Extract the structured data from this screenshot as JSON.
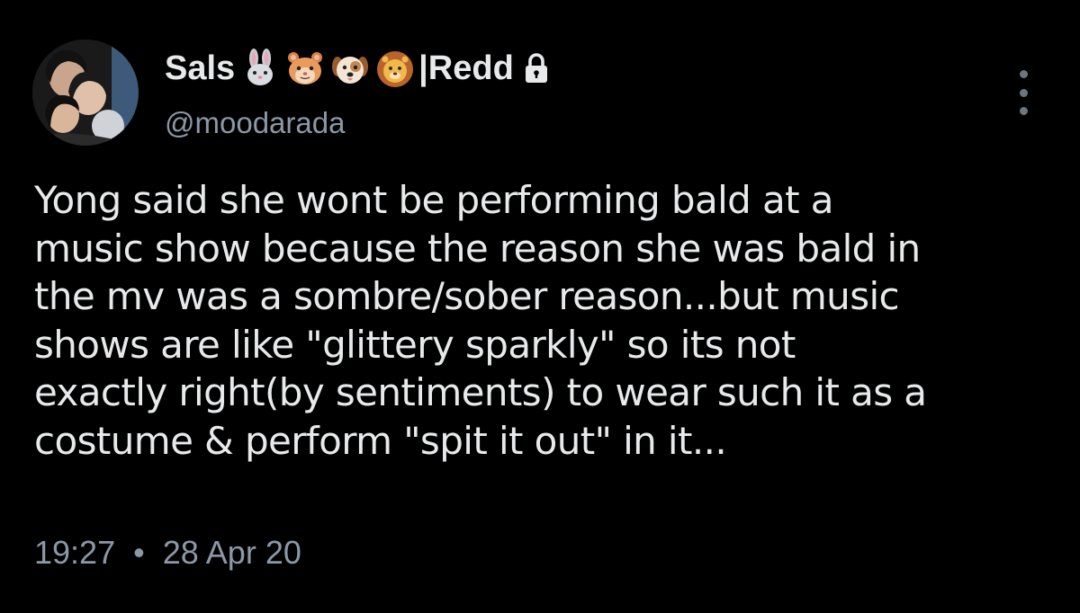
{
  "user": {
    "display_name": "Sals",
    "name_suffix": "|Redd",
    "handle": "@moodarada",
    "emoji_icons": [
      "rabbit-face-icon",
      "hamster-face-icon",
      "dog-face-icon",
      "lion-face-icon"
    ],
    "protected_icon": "lock-icon",
    "avatar": "profile-photo"
  },
  "tweet": {
    "lines": [
      "Yong said she wont be performing bald at a",
      "music show because the reason she was bald in",
      "the mv was a sombre/sober reason...but music",
      "shows are like \"glittery sparkly\" so its not",
      "exactly right(by sentiments) to wear such it as a",
      "costume & perform \"spit it out\" in it..."
    ],
    "time": "19:27",
    "separator": "•",
    "date": "28 Apr 20"
  },
  "menu": {
    "icon": "more-vertical-icon"
  },
  "colors": {
    "background": "#000000",
    "text_primary": "#e7e9ea",
    "text_secondary": "#8b98a5"
  }
}
